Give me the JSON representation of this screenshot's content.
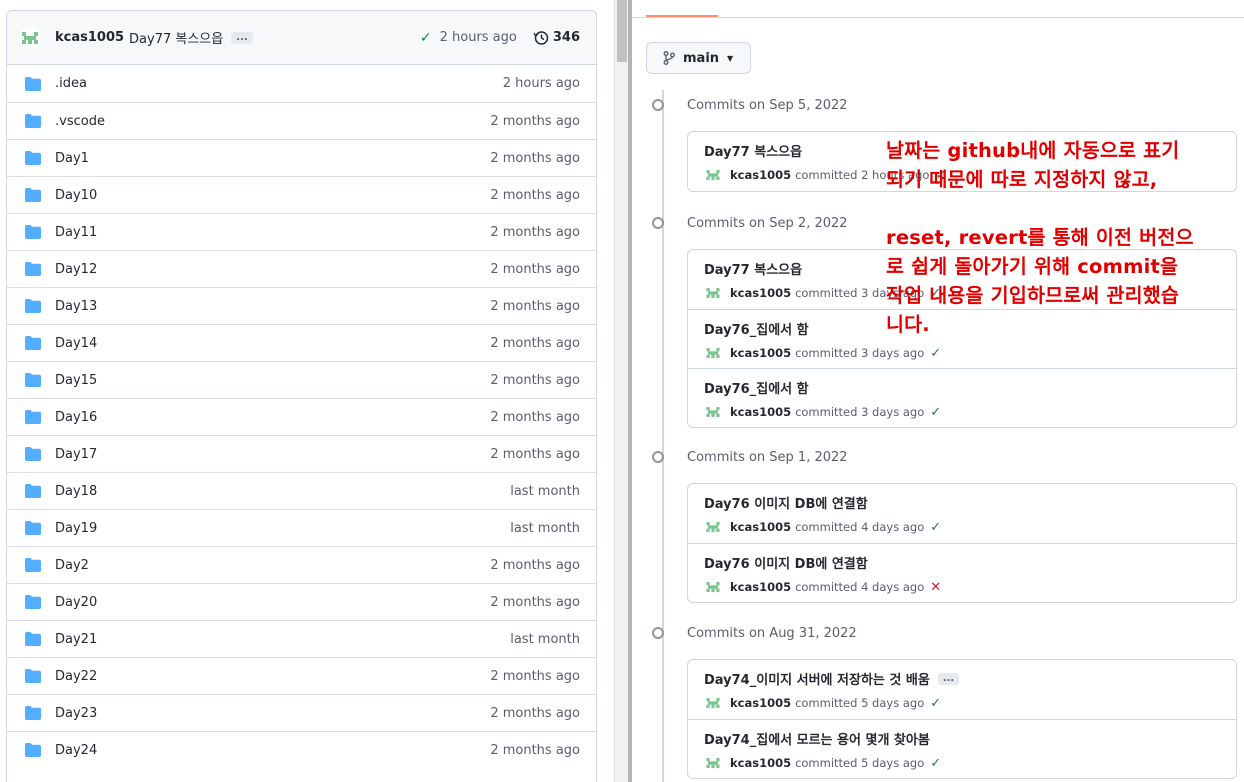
{
  "latest_commit": {
    "author": "kcas1005",
    "message": "Day77 복스으읍",
    "time": "2 hours ago",
    "commit_count": "346",
    "ellipsis": "..."
  },
  "files": [
    {
      "name": ".idea",
      "age": "2 hours ago"
    },
    {
      "name": ".vscode",
      "age": "2 months ago"
    },
    {
      "name": "Day1",
      "age": "2 months ago"
    },
    {
      "name": "Day10",
      "age": "2 months ago"
    },
    {
      "name": "Day11",
      "age": "2 months ago"
    },
    {
      "name": "Day12",
      "age": "2 months ago"
    },
    {
      "name": "Day13",
      "age": "2 months ago"
    },
    {
      "name": "Day14",
      "age": "2 months ago"
    },
    {
      "name": "Day15",
      "age": "2 months ago"
    },
    {
      "name": "Day16",
      "age": "2 months ago"
    },
    {
      "name": "Day17",
      "age": "2 months ago"
    },
    {
      "name": "Day18",
      "age": "last month"
    },
    {
      "name": "Day19",
      "age": "last month"
    },
    {
      "name": "Day2",
      "age": "2 months ago"
    },
    {
      "name": "Day20",
      "age": "2 months ago"
    },
    {
      "name": "Day21",
      "age": "last month"
    },
    {
      "name": "Day22",
      "age": "2 months ago"
    },
    {
      "name": "Day23",
      "age": "2 months ago"
    },
    {
      "name": "Day24",
      "age": "2 months ago"
    }
  ],
  "branch": "main",
  "commit_groups": [
    {
      "date": "Commits on Sep 5, 2022",
      "commits": [
        {
          "message": "Day77 복스으읍",
          "author": "kcas1005",
          "meta": "committed 2 hours ago",
          "status": "success"
        }
      ]
    },
    {
      "date": "Commits on Sep 2, 2022",
      "commits": [
        {
          "message": "Day77 복스으읍",
          "author": "kcas1005",
          "meta": "committed 3 days ago",
          "status": "success"
        },
        {
          "message": "Day76_집에서 함",
          "author": "kcas1005",
          "meta": "committed 3 days ago",
          "status": "success"
        },
        {
          "message": "Day76_집에서 함",
          "author": "kcas1005",
          "meta": "committed 3 days ago",
          "status": "success"
        }
      ]
    },
    {
      "date": "Commits on Sep 1, 2022",
      "commits": [
        {
          "message": "Day76 이미지 DB에 연결함",
          "author": "kcas1005",
          "meta": "committed 4 days ago",
          "status": "success"
        },
        {
          "message": "Day76 이미지 DB에 연결함",
          "author": "kcas1005",
          "meta": "committed 4 days ago",
          "status": "failure"
        }
      ]
    },
    {
      "date": "Commits on Aug 31, 2022",
      "commits": [
        {
          "message": "Day74_이미지 서버에 저장하는 것 배움",
          "author": "kcas1005",
          "meta": "committed 5 days ago",
          "status": "success",
          "ellipsis": "..."
        },
        {
          "message": "Day74_집에서 모르는 용어 몇개 찾아봄",
          "author": "kcas1005",
          "meta": "committed 5 days ago",
          "status": "success"
        }
      ]
    }
  ],
  "annotation": {
    "para1": "날짜는 github내에 자동으로 표기\n되기 때문에 따로 지정하지 않고,",
    "para2": "reset, revert를 통해 이전 버전으\n로 쉽게 돌아가기 위해 commit을\n작업 내용을 기입하므로써 관리했습\n니다."
  },
  "colors": {
    "folder": "#54aeff",
    "success": "#1a7f37",
    "failure": "#cf222e",
    "annotation": "#e00000",
    "tab_accent": "#fd8c73"
  }
}
